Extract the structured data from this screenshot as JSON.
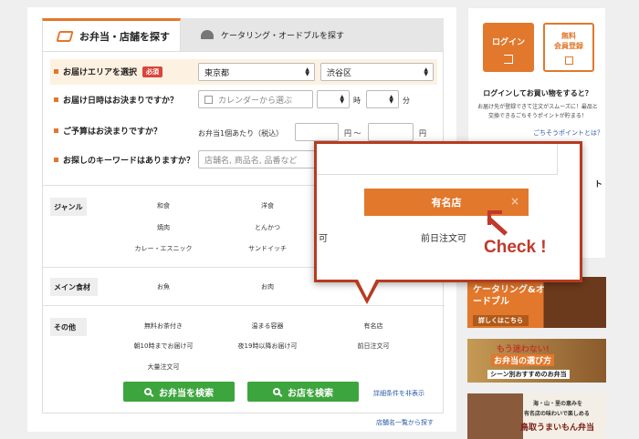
{
  "tabs": {
    "shop_search": "お弁当・店舗を探す",
    "catering_search": "ケータリング・オードブルを探す"
  },
  "form": {
    "area_question": "お届けエリアを選択",
    "required_badge": "必須",
    "prefecture": "東京都",
    "ward": "渋谷区",
    "date_question": "お届け日時はお決まりですか？",
    "date_placeholder": "カレンダーから選ぶ",
    "hour_unit": "時",
    "minute_unit": "分",
    "budget_question": "ご予算はお決まりですか？",
    "budget_label": "お弁当1個あたり（税込）",
    "yen1": "円 〜",
    "yen2": "円",
    "keyword_question": "お探しのキーワードはありますか？",
    "keyword_placeholder": "店舗名, 商品名, 品番など"
  },
  "categories": {
    "genre": {
      "label": "ジャンル",
      "items": [
        "和食",
        "洋食",
        "焼肉",
        "とんかつ",
        "カレー・エスニック",
        "サンドイッチ"
      ]
    },
    "main": {
      "label": "メイン食材",
      "items": [
        "お魚",
        "お肉"
      ]
    },
    "other": {
      "label": "その他",
      "items": [
        "無料お茶付き",
        "温まる容器",
        "有名店",
        "朝10時までお届け可",
        "夜19時以降お届け可",
        "前日注文可",
        "大量注文可"
      ]
    }
  },
  "buttons": {
    "bento_search": "お弁当を検索",
    "shop_search": "お店を検索",
    "hide_detail": "詳細条件を非表示",
    "shop_list": "店舗名一覧から探す"
  },
  "sidebar": {
    "login": "ログイン",
    "register_line1": "無料",
    "register_line2": "会員登録",
    "question": "ログインしてお買い物をすると？",
    "note": "お届け先が登録できて注文がスムーズに！最品と交換できるごちそうポイントが貯まる！",
    "point_link": "ごちそうポイントとは？"
  },
  "banners": {
    "catering_title": "ケータリング&オードブル",
    "catering_link": "詳しくはこちら",
    "b2_line1": "もう迷わない!",
    "b2_line2": "お弁当の選び方",
    "b2_line3": "シーン別おすすめのお弁当",
    "b3_line1": "海・山・里の恵みを",
    "b3_line2": "有名店の味わいで楽しめる",
    "b3_line3": "鳥取うまいもん弁当"
  },
  "popup": {
    "selected_tag": "有名店",
    "close": "×",
    "left_text": "可",
    "right_text": "前日注文可",
    "callout": "Check !"
  },
  "sidebar_peek": "ト",
  "colors": {
    "accent": "#e2782c",
    "green": "#3da53d",
    "callout_red": "#b83a1e"
  }
}
